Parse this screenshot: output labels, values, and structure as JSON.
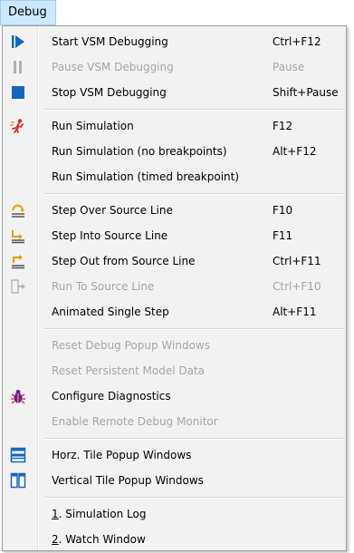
{
  "menubar": {
    "title": "Debug"
  },
  "items": {
    "start": {
      "label": "Start VSM Debugging",
      "shortcut": "Ctrl+F12"
    },
    "pause": {
      "label": "Pause VSM Debugging",
      "shortcut": "Pause"
    },
    "stop": {
      "label": "Stop VSM Debugging",
      "shortcut": "Shift+Pause"
    },
    "run": {
      "label": "Run Simulation",
      "shortcut": "F12"
    },
    "run_nobp": {
      "label": "Run Simulation (no breakpoints)",
      "shortcut": "Alt+F12"
    },
    "run_timed": {
      "label": "Run Simulation (timed breakpoint)",
      "shortcut": ""
    },
    "step_over": {
      "label": "Step Over Source Line",
      "shortcut": "F10"
    },
    "step_into": {
      "label": "Step Into Source Line",
      "shortcut": "F11"
    },
    "step_out": {
      "label": "Step Out from Source Line",
      "shortcut": "Ctrl+F11"
    },
    "run_to": {
      "label": "Run To Source Line",
      "shortcut": "Ctrl+F10"
    },
    "animated": {
      "label": "Animated Single Step",
      "shortcut": "Alt+F11"
    },
    "reset_popup": {
      "label": "Reset Debug Popup Windows",
      "shortcut": ""
    },
    "reset_model": {
      "label": "Reset Persistent Model Data",
      "shortcut": ""
    },
    "configure": {
      "label": "Configure Diagnostics",
      "shortcut": ""
    },
    "remote": {
      "label": "Enable Remote Debug Monitor",
      "shortcut": ""
    },
    "horz": {
      "label": "Horz. Tile Popup Windows",
      "shortcut": ""
    },
    "vert": {
      "label": "Vertical Tile Popup Windows",
      "shortcut": ""
    },
    "simlog": {
      "mnemonic": "1",
      "label": ". Simulation Log"
    },
    "watch": {
      "mnemonic": "2",
      "label": ". Watch Window"
    }
  },
  "icons": {
    "start": "play-debug-icon",
    "pause": "pause-icon",
    "stop": "stop-icon",
    "run": "run-simulation-icon",
    "step_over": "step-over-icon",
    "step_into": "step-into-icon",
    "step_out": "step-out-icon",
    "run_to": "run-to-line-icon",
    "configure": "bug-icon",
    "horz": "horizontal-tile-icon",
    "vert": "vertical-tile-icon"
  },
  "colors": {
    "menubar_highlight": "#cce8ff",
    "menu_background": "#f2f2f2",
    "disabled_text": "#a6a6a6",
    "icon_blue": "#1565c0"
  }
}
